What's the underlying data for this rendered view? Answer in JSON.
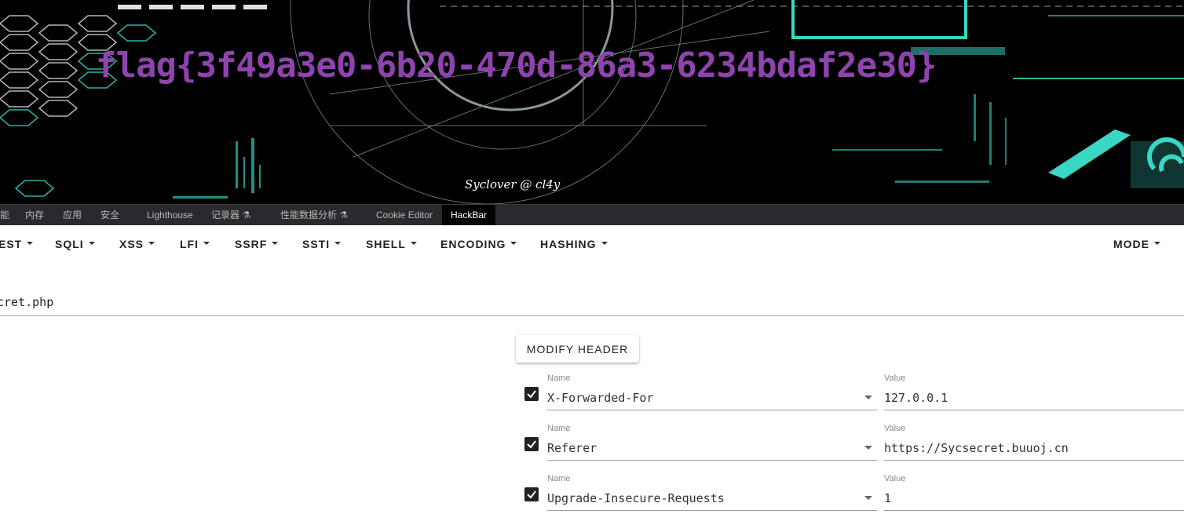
{
  "banner": {
    "flag_text": "flag{3f49a3e0-6b20-470d-86a3-6234bdaf2e30}",
    "credit_text": "Syclover @ cl4y"
  },
  "devtools": {
    "tabs": [
      {
        "label": "能"
      },
      {
        "label": "内存"
      },
      {
        "label": "应用"
      },
      {
        "label": "安全"
      },
      {
        "label": "Lighthouse"
      },
      {
        "label": "记录器 ⚗"
      },
      {
        "label": "性能数据分析 ⚗"
      },
      {
        "label": "Cookie Editor"
      },
      {
        "label": "HackBar"
      }
    ],
    "active_tab": "HackBar"
  },
  "hackbar": {
    "menus": [
      {
        "label": "EST"
      },
      {
        "label": "SQLI"
      },
      {
        "label": "XSS"
      },
      {
        "label": "LFI"
      },
      {
        "label": "SSRF"
      },
      {
        "label": "SSTI"
      },
      {
        "label": "SHELL"
      },
      {
        "label": "ENCODING"
      },
      {
        "label": "HASHING"
      },
      {
        "label": "MODE"
      }
    ],
    "url_value": "cret.php",
    "modify_header_label": "MODIFY HEADER",
    "name_label": "Name",
    "value_label": "Value",
    "headers": [
      {
        "name": "X-Forwarded-For",
        "value": "127.0.0.1",
        "checked": true
      },
      {
        "name": "Referer",
        "value": "https://Sycsecret.buuoj.cn",
        "checked": true
      },
      {
        "name": "Upgrade-Insecure-Requests",
        "value": "1",
        "checked": true
      }
    ]
  }
}
